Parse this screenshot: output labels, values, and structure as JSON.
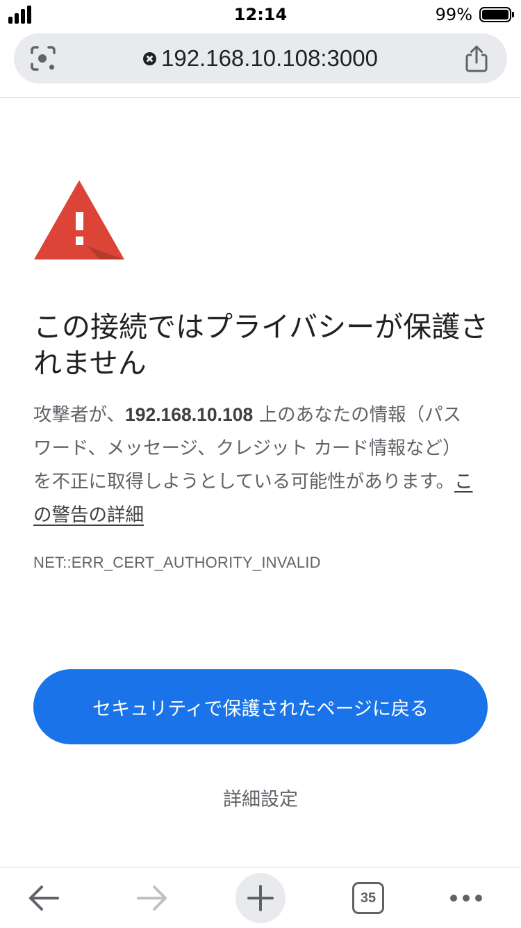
{
  "status_bar": {
    "time": "12:14",
    "battery_percent": "99%",
    "battery_level": 0.99,
    "signal_icon": "signal-bars-icon",
    "battery_icon": "battery-icon"
  },
  "address_bar": {
    "url": "192.168.10.108:3000",
    "security_icon": "insecure-connection-icon",
    "left_icon": "lens-search-icon",
    "right_icon": "share-icon"
  },
  "interstitial": {
    "heading": "この接続ではプライバシーが保護されません",
    "body_prefix": "攻撃者が、",
    "body_host": "192.168.10.108",
    "body_suffix": " 上のあなたの情報（パスワード、メッセージ、クレジット カード情報など）を不正に取得しようとしている可能性があります。",
    "details_link": "この警告の詳細",
    "error_code": "NET::ERR_CERT_AUTHORITY_INVALID",
    "back_button": "セキュリティで保護されたページに戻る",
    "advanced_button": "詳細設定"
  },
  "toolbar": {
    "tab_count": "35",
    "back_icon": "back-arrow-icon",
    "forward_icon": "forward-arrow-icon",
    "new_tab_icon": "plus-icon",
    "tabs_icon": "tab-switcher-icon",
    "menu_icon": "more-dots-icon"
  },
  "colors": {
    "accent": "#1a73e8",
    "warning": "#db4437",
    "address_bar_bg": "#e8eaed"
  }
}
